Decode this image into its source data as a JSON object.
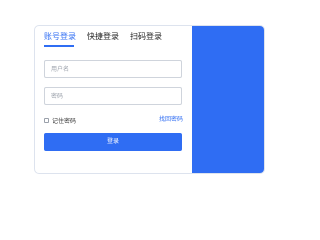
{
  "login": {
    "tabs": [
      {
        "label": "账号登录",
        "active": true
      },
      {
        "label": "快捷登录",
        "active": false
      },
      {
        "label": "扫码登录",
        "active": false
      }
    ],
    "username": {
      "placeholder": "用户名",
      "value": ""
    },
    "password": {
      "placeholder": "密码",
      "value": ""
    },
    "remember_label": "记住密码",
    "remember_checked": false,
    "forgot_label": "找回密码",
    "submit_label": "登录"
  },
  "colors": {
    "accent": "#2f6df3",
    "border": "#dde3ee",
    "input_border": "#cfd4dc"
  }
}
